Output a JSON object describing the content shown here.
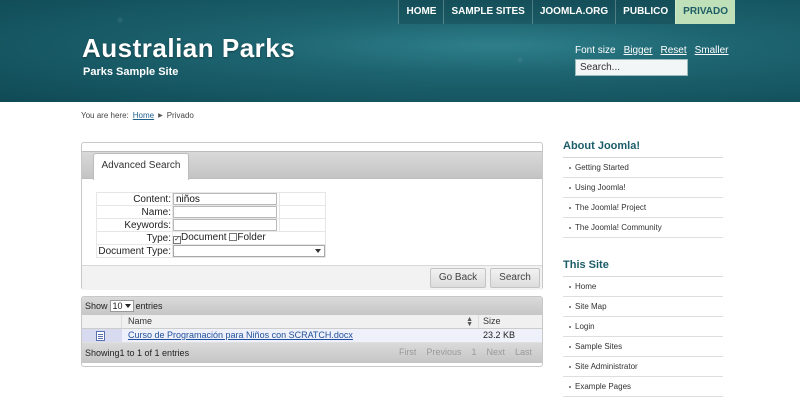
{
  "header": {
    "site_title": "Australian Parks",
    "site_subtitle": "Parks Sample Site",
    "nav": [
      {
        "label": "HOME"
      },
      {
        "label": "SAMPLE SITES"
      },
      {
        "label": "JOOMLA.ORG"
      },
      {
        "label": "PUBLICO"
      },
      {
        "label": "PRIVADO",
        "active": true
      }
    ],
    "font_size_label": "Font size",
    "font_bigger": "Bigger",
    "font_reset": "Reset",
    "font_smaller": "Smaller",
    "search_value": "Search..."
  },
  "breadcrumb": {
    "prefix": "You are here:",
    "home": "Home",
    "current": "Privado"
  },
  "search_panel": {
    "tab_label": "Advanced Search",
    "content_label": "Content:",
    "content_value": "niños",
    "name_label": "Name:",
    "name_value": "",
    "keywords_label": "Keywords:",
    "keywords_value": "",
    "type_label": "Type:",
    "type_document": "Document",
    "type_document_checked": true,
    "type_folder": "Folder",
    "type_folder_checked": false,
    "doctype_label": "Document Type:",
    "doctype_value": "",
    "go_back": "Go Back",
    "search": "Search"
  },
  "results": {
    "show_label": "Show",
    "length_value": "10",
    "entries_label": "entries",
    "columns": [
      "Name",
      "Size"
    ],
    "rows": [
      {
        "name": "Curso de Programación para Niños con SCRATCH.docx",
        "size": "23.2 KB",
        "icon": "word-document-icon"
      }
    ],
    "info": "Showing1 to 1 of 1 entries",
    "pager": {
      "first": "First",
      "previous": "Previous",
      "page": "1",
      "next": "Next",
      "last": "Last"
    }
  },
  "sidebar": {
    "about_title": "About Joomla!",
    "about_items": [
      "Getting Started",
      "Using Joomla!",
      "The Joomla! Project",
      "The Joomla! Community"
    ],
    "site_title": "This Site",
    "site_items": [
      "Home",
      "Site Map",
      "Login",
      "Sample Sites",
      "Site Administrator",
      "Example Pages"
    ]
  },
  "colors": {
    "header_bg": "#1d6470",
    "active_nav_bg": "#bfe0b8",
    "sidebar_heading": "#1c5c68",
    "link": "#1f4f9c"
  }
}
